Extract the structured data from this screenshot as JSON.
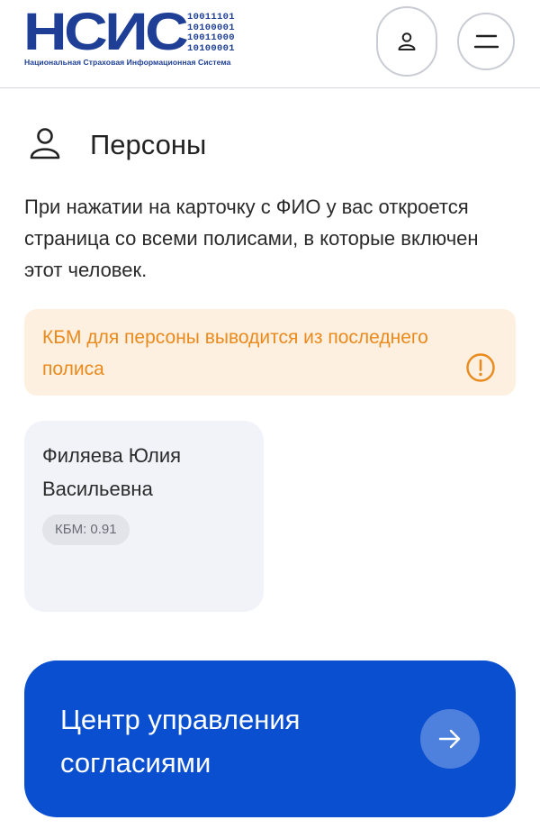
{
  "header": {
    "logo": {
      "letters": "НСИС",
      "binary": [
        "10011101",
        "10100001",
        "10011000",
        "10100001"
      ],
      "caption": "Национальная Страховая Информационная Система",
      "color": "#1e3f95"
    },
    "profile_icon": "user-icon",
    "menu_icon": "hamburger-menu-icon"
  },
  "section": {
    "icon": "person-icon",
    "title": "Персоны",
    "description": "При нажатии на карточку с ФИО у вас откроется страница со всеми полисами, в которые включен этот человек."
  },
  "notice": {
    "text": "КБМ для персоны выводится из последнего полиса",
    "icon": "exclamation-circle-icon",
    "text_color": "#ea8a1c",
    "background": "#fdf0e0"
  },
  "persons": [
    {
      "name": "Филяева Юлия Васильевна",
      "kbm": "КБМ: 0.91"
    }
  ],
  "consent_banner": {
    "label": "Центр управления согласиями",
    "icon": "arrow-right-icon",
    "background": "#0a4fd0"
  }
}
